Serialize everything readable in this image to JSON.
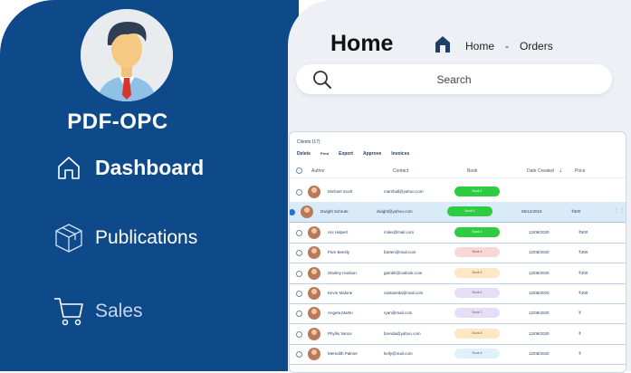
{
  "sidebar": {
    "brand": "PDF-OPC",
    "nav": [
      {
        "label": "Dashboard",
        "icon": "home-icon"
      },
      {
        "label": "Publications",
        "icon": "box-icon"
      },
      {
        "label": "Sales",
        "icon": "cart-icon"
      }
    ]
  },
  "header": {
    "title": "Home",
    "breadcrumb": {
      "home": "Home",
      "sep": "-",
      "current": "Orders"
    }
  },
  "search": {
    "placeholder": "Search"
  },
  "table": {
    "title": "Clients (17)",
    "toolbar": [
      "Delete",
      "Print",
      "Export",
      "Approve",
      "Invoices"
    ],
    "columns": [
      "Author",
      "Contact",
      "Book",
      "Date Created",
      "Price"
    ],
    "rows": [
      {
        "author": "Michael Scott",
        "email": "marshall@yahoo.com",
        "book": "Book 1",
        "date": "",
        "price": "",
        "badge": "#2ecc40"
      },
      {
        "author": "Dwight Schrute",
        "email": "dwight@yahoo.com",
        "book": "Book 2",
        "date": "05/12/2019",
        "price": "₹600",
        "badge": "#2ecc40"
      },
      {
        "author": "Ani Halpert",
        "email": "miles@mail.com",
        "book": "Book 3",
        "date": "12/08/2020",
        "price": "₹600",
        "badge": "#2ecc40"
      },
      {
        "author": "Pam Beesly",
        "email": "barten@mail.com",
        "book": "Book 4",
        "date": "12/08/2020",
        "price": "₹300",
        "badge": "#f8d7d7"
      },
      {
        "author": "Stanley Hudson",
        "email": "gambit@outlook.com",
        "book": "Book 5",
        "date": "12/08/2020",
        "price": "₹400",
        "badge": "#fde7c4"
      },
      {
        "author": "Kevin Malone",
        "email": "castaneda@mail.com",
        "book": "Book 6",
        "date": "12/08/2020",
        "price": "₹400",
        "badge": "#e6def7"
      },
      {
        "author": "Angela Martin",
        "email": "ryan@mail.com",
        "book": "Book 7",
        "date": "12/08/2020",
        "price": "₹",
        "badge": "#e6def7"
      },
      {
        "author": "Phyllis Vance",
        "email": "brenda@yahoo.com",
        "book": "Book 8",
        "date": "12/08/2020",
        "price": "₹",
        "badge": "#fde7c4"
      },
      {
        "author": "Meredith Palmer",
        "email": "kelly@mail.com",
        "book": "Book 9",
        "date": "12/08/2020",
        "price": "₹",
        "badge": "#dff1fb"
      }
    ]
  },
  "colors": {
    "sidebar": "#0e4a8a",
    "accent": "#2ecc40"
  }
}
